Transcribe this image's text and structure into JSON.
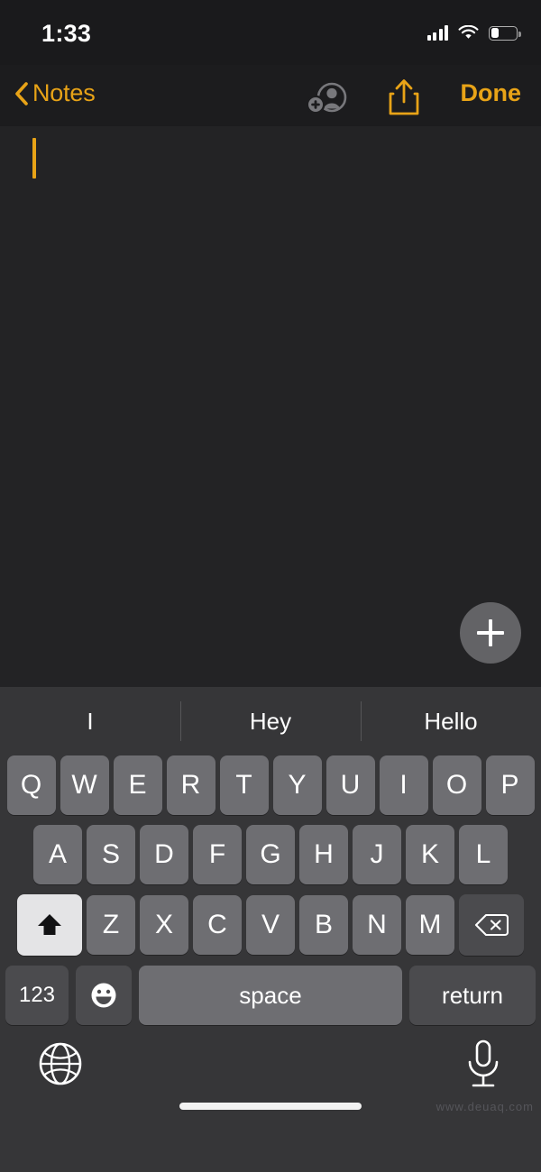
{
  "status_bar": {
    "time": "1:33",
    "cellular_icon": "cellular-signal-icon",
    "wifi_icon": "wifi-icon",
    "battery_icon": "battery-icon",
    "battery_level_percent": 30
  },
  "nav_bar": {
    "back_label": "Notes",
    "back_icon": "chevron-left-icon",
    "collaborate_icon": "add-person-icon",
    "share_icon": "share-icon",
    "done_label": "Done",
    "accent_color": "#e8a317",
    "disabled_color": "#78787c"
  },
  "note": {
    "body_text": "",
    "caret_visible": true,
    "background_color": "#232325",
    "add_attachment_icon": "plus-icon"
  },
  "keyboard": {
    "predictions": [
      "I",
      "Hey",
      "Hello"
    ],
    "row1": [
      "Q",
      "W",
      "E",
      "R",
      "T",
      "Y",
      "U",
      "I",
      "O",
      "P"
    ],
    "row2": [
      "A",
      "S",
      "D",
      "F",
      "G",
      "H",
      "J",
      "K",
      "L"
    ],
    "row3_letters": [
      "Z",
      "X",
      "C",
      "V",
      "B",
      "N",
      "M"
    ],
    "shift_icon": "shift-arrow-icon",
    "shift_active": true,
    "delete_icon": "backspace-delete-icon",
    "numeric_label": "123",
    "emoji_icon": "smiley-face-icon",
    "space_label": "space",
    "return_label": "return",
    "globe_icon": "globe-language-icon",
    "dictation_icon": "microphone-icon",
    "key_color": "#6e6e72",
    "dark_key_color": "#4b4b4e",
    "active_key_color": "#e4e4e6",
    "background_color": "#363638"
  },
  "footer": {
    "home_indicator": "home-indicator",
    "watermark": "www.deuaq.com"
  }
}
